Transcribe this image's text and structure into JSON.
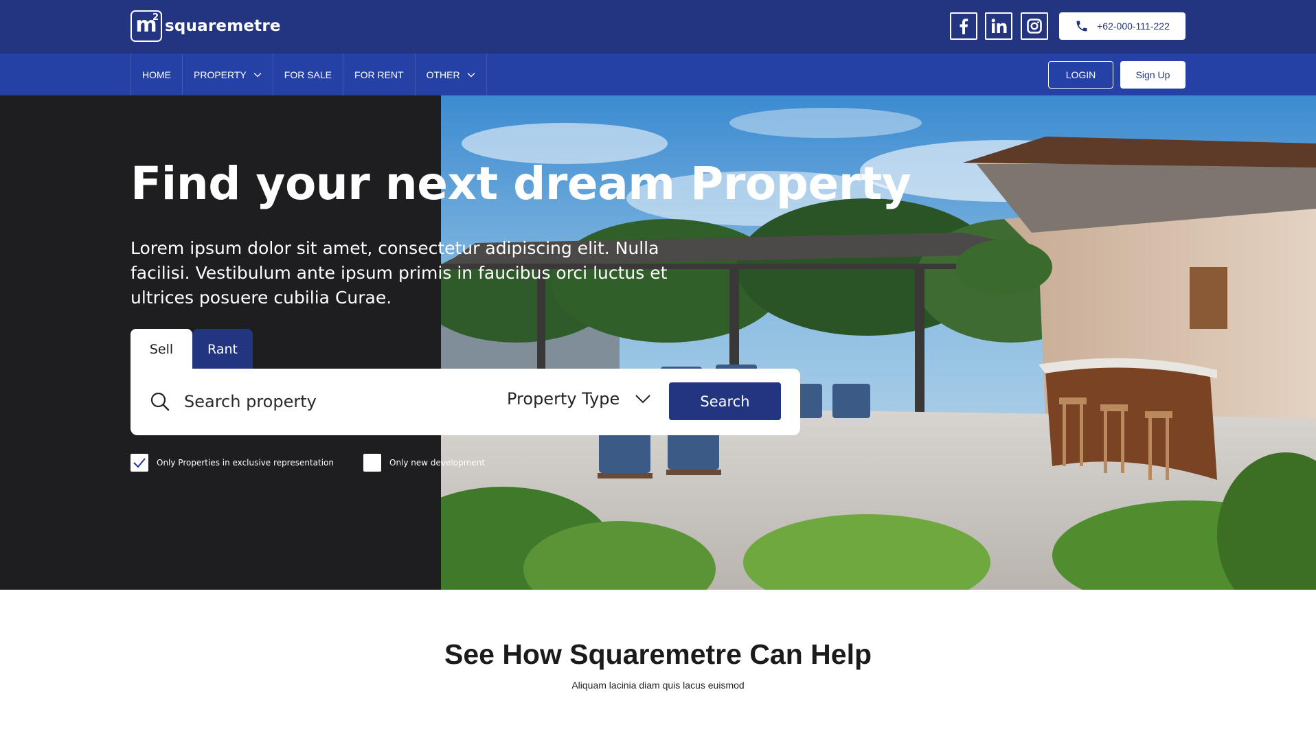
{
  "brand": {
    "logo_mark": "m",
    "logo_sup": "2",
    "name": "squaremetre"
  },
  "header": {
    "social": [
      "facebook-icon",
      "linkedin-icon",
      "instagram-icon"
    ],
    "phone": "+62-000-111-222"
  },
  "nav": {
    "items": [
      {
        "label": "HOME",
        "dropdown": false
      },
      {
        "label": "PROPERTY",
        "dropdown": true
      },
      {
        "label": "FOR SALE",
        "dropdown": false
      },
      {
        "label": "FOR RENT",
        "dropdown": false
      },
      {
        "label": "OTHER",
        "dropdown": true
      }
    ],
    "login": "LOGIN",
    "signup": "Sign Up"
  },
  "hero": {
    "title": "Find your next dream Property",
    "description": "Lorem ipsum dolor sit amet, consectetur adipiscing elit. Nulla facilisi. Vestibulum ante ipsum primis in faucibus orci luctus et ultrices posuere cubilia Curae.",
    "tabs": {
      "sell": "Sell",
      "rant": "Rant",
      "active": "Sell"
    },
    "search": {
      "placeholder": "Search property",
      "value": ""
    },
    "property_type": "Property Type",
    "search_button": "Search",
    "checkboxes": [
      {
        "label": "Only Properties in exclusive representation",
        "checked": true
      },
      {
        "label": "Only new development",
        "checked": false
      }
    ]
  },
  "help": {
    "title": "See How Squaremetre Can Help",
    "subtitle": "Aliquam lacinia diam quis lacus euismod"
  },
  "colors": {
    "primary": "#233580",
    "nav": "#2541a6",
    "hero_dark": "#1e1e20"
  }
}
